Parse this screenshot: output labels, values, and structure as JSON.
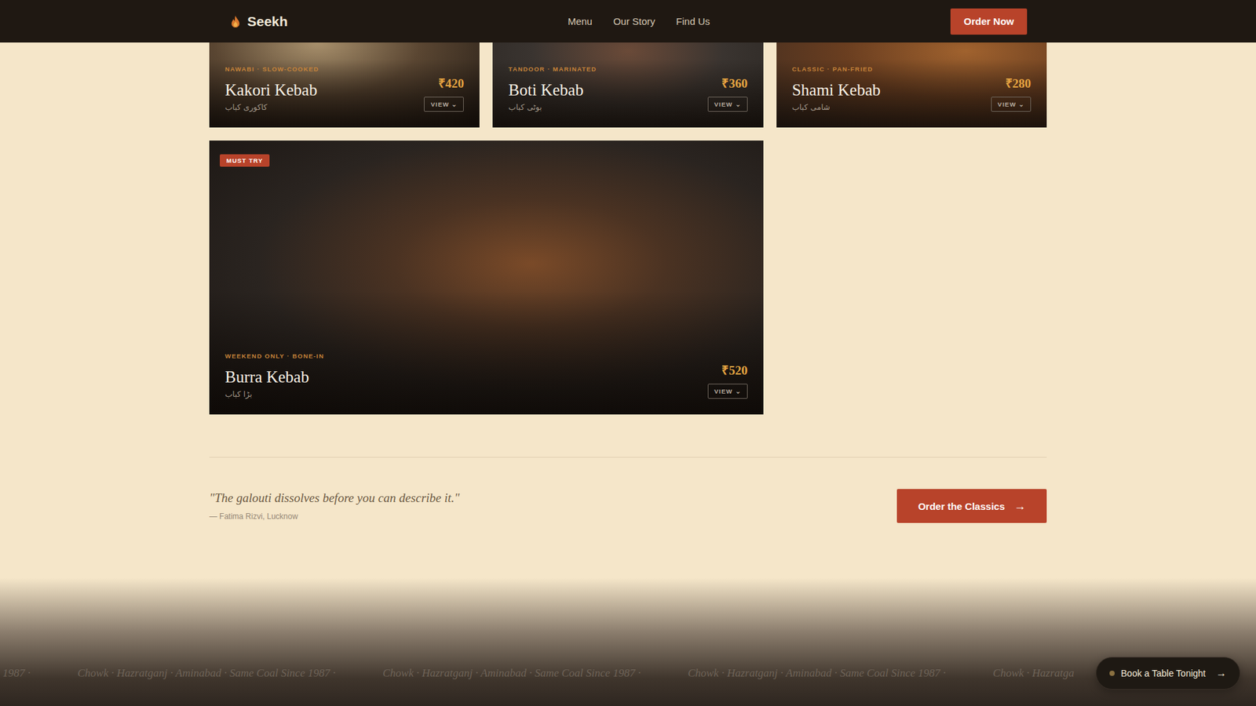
{
  "brand": {
    "name": "Seekh"
  },
  "nav": [
    {
      "label": "Menu"
    },
    {
      "label": "Our Story"
    },
    {
      "label": "Find Us"
    }
  ],
  "header_button": "Order Now",
  "dishes": [
    {
      "kind": "standard",
      "badge": null,
      "tag": "NAWABI · SLOW-COOKED",
      "name": "Kakori Kebab",
      "urdu": "کاکوری کباب",
      "price": "₹420",
      "view": "VIEW ⌄"
    },
    {
      "kind": "standard",
      "badge": null,
      "tag": "TANDOOR · MARINATED",
      "name": "Boti Kebab",
      "urdu": "بوٹی کباب",
      "price": "₹360",
      "view": "VIEW ⌄"
    },
    {
      "kind": "standard",
      "badge": null,
      "tag": "CLASSIC · PAN-FRIED",
      "name": "Shami Kebab",
      "urdu": "شامی کباب",
      "price": "₹280",
      "view": "VIEW ⌄"
    },
    {
      "kind": "wide",
      "badge": "MUST TRY",
      "tag": "WEEKEND ONLY · BONE-IN",
      "name": "Burra Kebab",
      "urdu": "بڑا کباب",
      "price": "₹520",
      "view": "VIEW ⌄"
    }
  ],
  "quote": {
    "text": "\"The galouti dissolves before you can describe it.\"",
    "author": "— Fatima Rizvi, Lucknow"
  },
  "cta": {
    "label": "Order the Classics",
    "icon": "→"
  },
  "marquee": [
    "1987 ·",
    "Chowk · Hazratganj · Aminabad · Same Coal Since 1987 ·",
    "Chowk · Hazratganj · Aminabad · Same Coal Since 1987 ·",
    "Chowk · Hazratganj · Aminabad · Same Coal Since 1987 ·",
    "Chowk · Hazratga"
  ],
  "book": {
    "label": "Book a Table Tonight",
    "icon": "→"
  }
}
